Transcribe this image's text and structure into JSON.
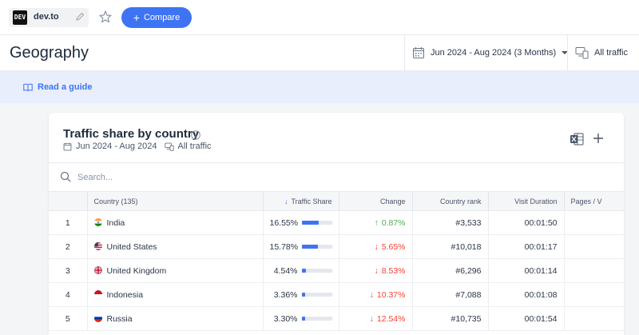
{
  "topbar": {
    "logo_text": "DEV",
    "site_name": "dev.to",
    "compare_label": "Compare"
  },
  "header": {
    "title": "Geography",
    "date_range": "Jun 2024 - Aug 2024 (3 Months)",
    "traffic_filter": "All traffic"
  },
  "guide": {
    "label": "Read a guide"
  },
  "card": {
    "title": "Traffic share by country",
    "date": "Jun 2024 - Aug 2024",
    "traffic": "All traffic",
    "search_placeholder": "Search..."
  },
  "table": {
    "headers": {
      "country": "Country (135)",
      "share": "Traffic Share",
      "change": "Change",
      "rank": "Country rank",
      "duration": "Visit Duration",
      "pages": "Pages / V"
    },
    "rows": [
      {
        "num": "1",
        "country": "India",
        "flag": "india-flag",
        "share": "16.55%",
        "share_value": 16.55,
        "change": "0.87%",
        "direction": "up",
        "rank": "#3,533",
        "duration": "00:01:50"
      },
      {
        "num": "2",
        "country": "United States",
        "flag": "us-flag",
        "share": "15.78%",
        "share_value": 15.78,
        "change": "5.65%",
        "direction": "down",
        "rank": "#10,018",
        "duration": "00:01:17"
      },
      {
        "num": "3",
        "country": "United Kingdom",
        "flag": "uk-flag",
        "share": "4.54%",
        "share_value": 4.54,
        "change": "8.53%",
        "direction": "down",
        "rank": "#6,296",
        "duration": "00:01:14"
      },
      {
        "num": "4",
        "country": "Indonesia",
        "flag": "indonesia-flag",
        "share": "3.36%",
        "share_value": 3.36,
        "change": "10.37%",
        "direction": "down",
        "rank": "#7,088",
        "duration": "00:01:08"
      },
      {
        "num": "5",
        "country": "Russia",
        "flag": "russia-flag",
        "share": "3.30%",
        "share_value": 3.3,
        "change": "12.54%",
        "direction": "down",
        "rank": "#10,735",
        "duration": "00:01:54"
      }
    ]
  },
  "colors": {
    "accent": "#3e74f4",
    "up": "#4caf50",
    "down": "#f44336"
  }
}
